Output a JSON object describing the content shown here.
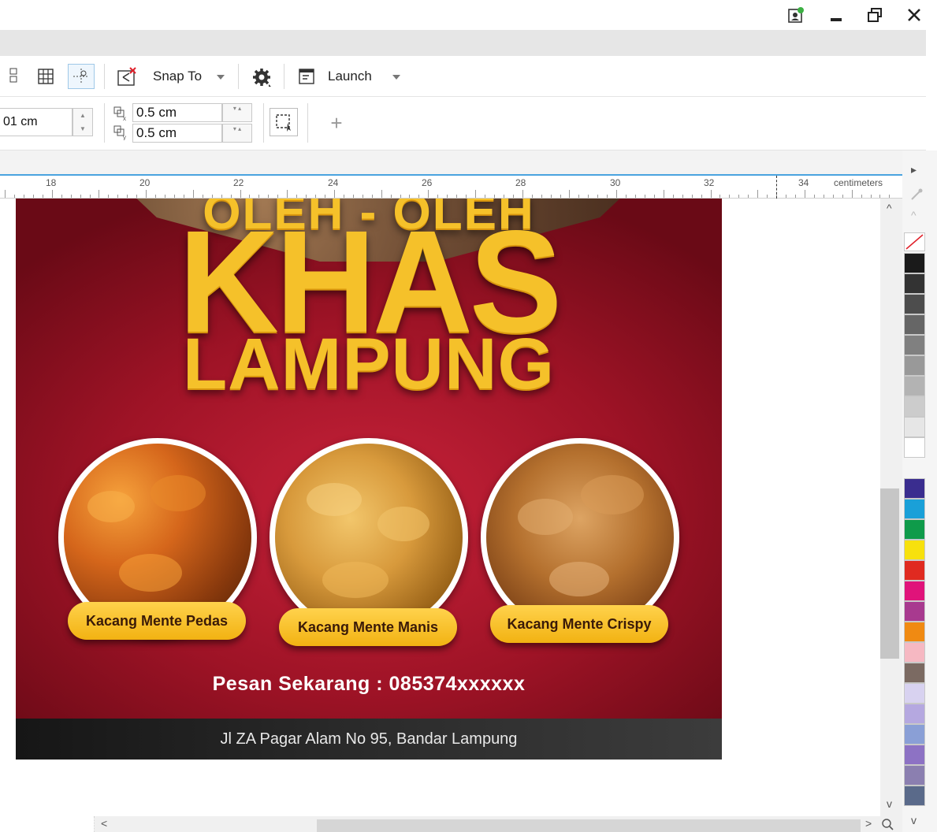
{
  "window": {
    "controls": {
      "account_icon": "user-sync-icon",
      "minimize": "minimize-icon",
      "restore": "restore-icon",
      "close": "close-icon"
    }
  },
  "toolbar": {
    "snap_label": "Snap To",
    "launch_label": "Launch",
    "size_field_value": "01 cm",
    "dup_x_value": "0.5 cm",
    "dup_y_value": "0.5 cm"
  },
  "ruler": {
    "unit_label": "centimeters",
    "ticks": [
      "18",
      "20",
      "22",
      "24",
      "26",
      "28",
      "30",
      "32",
      "34"
    ]
  },
  "design": {
    "heading_top": "OLEH - OLEH",
    "heading_main": "KHAS",
    "heading_sub": "LAMPUNG",
    "products": [
      {
        "label": "Kacang Mente Pedas"
      },
      {
        "label": "Kacang Mente Manis"
      },
      {
        "label": "Kacang Mente Crispy"
      }
    ],
    "order_text": "Pesan Sekarang : 085374xxxxxx",
    "address": "Jl ZA Pagar Alam No 95, Bandar Lampung"
  },
  "palette": {
    "colors": [
      "#1a1a1a",
      "#333333",
      "#4d4d4d",
      "#666666",
      "#808080",
      "#999999",
      "#b3b3b3",
      "#cccccc",
      "#e6e6e6",
      "#ffffff",
      "#3a2d8f",
      "#1aa0d8",
      "#0f9b4a",
      "#f7e10d",
      "#e02a20",
      "#e0137a",
      "#a83a8f",
      "#f08a12",
      "#f6b8c2",
      "#7b6a62",
      "#d8d2f0",
      "#b5a8e0",
      "#8a9fd6",
      "#8d72c4",
      "#8b7fb0",
      "#5a6a8a"
    ]
  },
  "colors": {
    "accent_blue": "#4aa3df",
    "poster_red": "#b51a2e",
    "pill_gold": "#f5c12a"
  }
}
